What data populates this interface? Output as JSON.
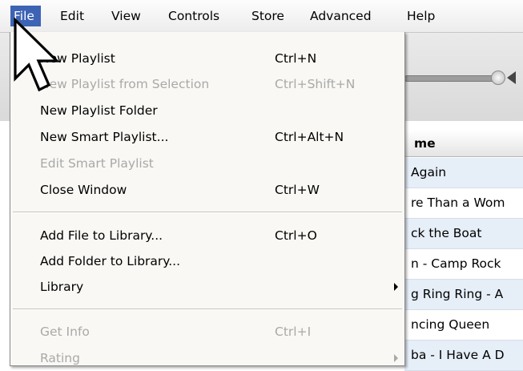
{
  "menubar": {
    "items": [
      {
        "label": "File"
      },
      {
        "label": "Edit"
      },
      {
        "label": "View"
      },
      {
        "label": "Controls"
      },
      {
        "label": "Store"
      },
      {
        "label": "Advanced"
      },
      {
        "label": "Help"
      }
    ]
  },
  "file_menu": {
    "items": [
      {
        "label": "New Playlist",
        "shortcut": "Ctrl+N",
        "enabled": true
      },
      {
        "label": "New Playlist from Selection",
        "shortcut": "Ctrl+Shift+N",
        "enabled": false
      },
      {
        "label": "New Playlist Folder",
        "shortcut": "",
        "enabled": true
      },
      {
        "label": "New Smart Playlist...",
        "shortcut": "Ctrl+Alt+N",
        "enabled": true
      },
      {
        "label": "Edit Smart Playlist",
        "shortcut": "",
        "enabled": false
      },
      {
        "label": "Close Window",
        "shortcut": "Ctrl+W",
        "enabled": true
      },
      {
        "label": "Add File to Library...",
        "shortcut": "Ctrl+O",
        "enabled": true
      },
      {
        "label": "Add Folder to Library...",
        "shortcut": "",
        "enabled": true
      },
      {
        "label": "Library",
        "shortcut": "",
        "enabled": true,
        "submenu": true
      },
      {
        "label": "Get Info",
        "shortcut": "Ctrl+I",
        "enabled": false
      },
      {
        "label": "Rating",
        "shortcut": "",
        "enabled": false,
        "submenu": true
      }
    ]
  },
  "song_list": {
    "column_header": "me",
    "rows": [
      {
        "name": "Again"
      },
      {
        "name": "re Than a Wom"
      },
      {
        "name": "ck the Boat"
      },
      {
        "name": "n - Camp Rock"
      },
      {
        "name": "g Ring Ring - A"
      },
      {
        "name": "ncing Queen"
      },
      {
        "name": "ba - I Have A D"
      }
    ]
  },
  "colors": {
    "menu_highlight": "#3d63b5",
    "menu_background": "#f9f8f4",
    "disabled_text": "#a9a9a9",
    "row_alt": "#e6eef8"
  },
  "icons": {
    "cursor": "arrow-cursor-icon",
    "volume": "speaker-icon",
    "submenu": "chevron-right-icon"
  }
}
